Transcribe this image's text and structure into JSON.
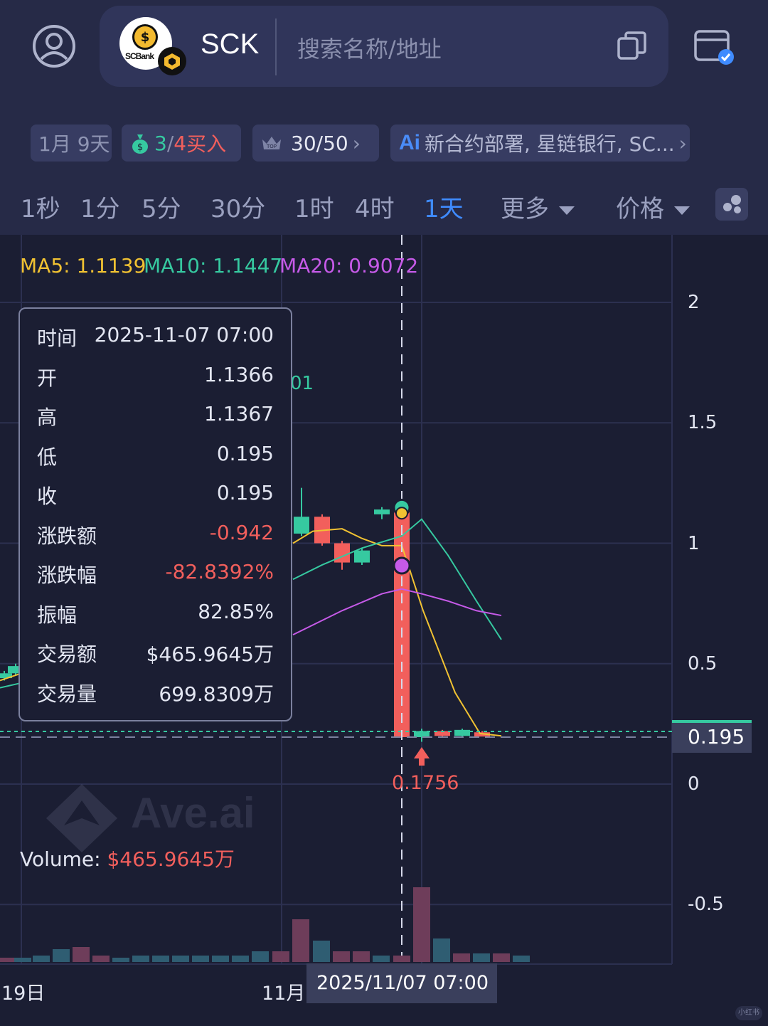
{
  "header": {
    "token_symbol": "SCK",
    "logo_text": "SCBank",
    "search_placeholder": "搜索名称/地址",
    "icons": [
      "user-icon",
      "copy-icon",
      "wallet-icon"
    ]
  },
  "chips": {
    "age": "1月 9天",
    "buy_count_a": "3",
    "buy_sep": "/",
    "buy_count_b": "4",
    "buy_label": "买入",
    "top_label": "30/50",
    "ai_summary": "新合约部署, 星链银行, SC..."
  },
  "timeframes": [
    "1秒",
    "1分",
    "5分",
    "30分",
    "1时",
    "4时",
    "1天"
  ],
  "active_timeframe": "1天",
  "more_label": "更多",
  "price_label": "价格",
  "ma": {
    "ma5": "MA5: 1.1139",
    "ma10": "MA10: 1.1447",
    "ma20": "MA20: 0.9072"
  },
  "tooltip": {
    "rows": [
      {
        "label": "时间",
        "value": "2025-11-07 07:00",
        "red": false
      },
      {
        "label": "开",
        "value": "1.1366",
        "red": false
      },
      {
        "label": "高",
        "value": "1.1367",
        "red": false
      },
      {
        "label": "低",
        "value": "0.195",
        "red": false
      },
      {
        "label": "收",
        "value": "0.195",
        "red": false
      },
      {
        "label": "涨跌额",
        "value": "-0.942",
        "red": true
      },
      {
        "label": "涨跌幅",
        "value": "-82.8392%",
        "red": true
      },
      {
        "label": "振幅",
        "value": "82.85%",
        "red": false
      },
      {
        "label": "交易额",
        "value": "$465.9645万",
        "red": false
      },
      {
        "label": "交易量",
        "value": "699.8309万",
        "red": false
      }
    ]
  },
  "volume_label": "Volume:",
  "volume_value": "$465.9645万",
  "current_price": "0.195",
  "low_marker": "0.1756",
  "peek_label": "01",
  "crosshair_date": "2025/11/07   07:00",
  "watermark": "Ave.ai",
  "corner_mark": "小红书",
  "chart_data": {
    "type": "candlestick",
    "y_ticks": [
      2,
      1.5,
      1,
      0.5,
      0,
      -0.5
    ],
    "y_tick_labels": [
      "2",
      "1.5",
      "1",
      "0.5",
      "0",
      "-0.5"
    ],
    "x_tick_labels": [
      "19日",
      "11月"
    ],
    "ylim": [
      -0.75,
      2.3
    ],
    "candles": [
      {
        "o": 0.44,
        "c": 0.46,
        "h": 0.47,
        "l": 0.43
      },
      {
        "o": 0.46,
        "c": 0.49,
        "h": 0.5,
        "l": 0.45
      },
      {
        "o": 1.04,
        "c": 1.11,
        "h": 1.23,
        "l": 1.03
      },
      {
        "o": 1.11,
        "c": 1.0,
        "h": 1.12,
        "l": 0.99
      },
      {
        "o": 1.0,
        "c": 0.92,
        "h": 1.01,
        "l": 0.89
      },
      {
        "o": 0.92,
        "c": 0.97,
        "h": 0.98,
        "l": 0.91
      },
      {
        "o": 1.12,
        "c": 1.14,
        "h": 1.15,
        "l": 1.1
      },
      {
        "o": 1.1366,
        "c": 0.195,
        "h": 1.1367,
        "l": 0.195
      },
      {
        "o": 0.195,
        "c": 0.22,
        "h": 0.23,
        "l": 0.1756
      },
      {
        "o": 0.22,
        "c": 0.2,
        "h": 0.225,
        "l": 0.195
      },
      {
        "o": 0.2,
        "c": 0.225,
        "h": 0.23,
        "l": 0.195
      },
      {
        "o": 0.215,
        "c": 0.2,
        "h": 0.22,
        "l": 0.198
      }
    ],
    "volume": [
      2,
      2,
      3,
      6,
      7,
      3,
      2,
      3,
      3,
      3,
      3,
      3,
      3,
      5,
      5,
      20,
      10,
      5,
      5,
      3,
      3,
      35,
      11,
      4,
      4,
      4,
      3
    ],
    "volume_up": [
      false,
      true,
      true,
      true,
      false,
      false,
      true,
      true,
      true,
      true,
      true,
      true,
      true,
      true,
      false,
      false,
      true,
      false,
      false,
      true,
      false,
      false,
      true,
      false,
      true,
      false,
      true
    ]
  },
  "colors": {
    "up": "#36c9a0",
    "down": "#f25f5c",
    "ma5": "#f1c232",
    "ma10": "#36c9a0",
    "ma20": "#c65ae8",
    "background": "#1b1e33",
    "panel": "#262a47"
  }
}
